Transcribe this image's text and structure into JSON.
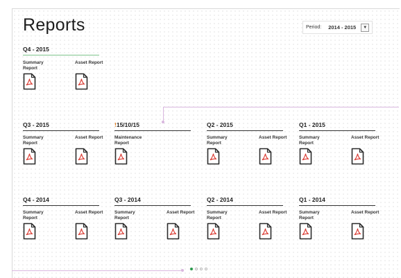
{
  "page": {
    "title": "Reports"
  },
  "period": {
    "label": "Period:",
    "value": "2014 - 2015",
    "dropdown_icon": "triangle-down-icon"
  },
  "colors": {
    "accent_green": "#2a9a4c",
    "pdf_red": "#d9342b",
    "connector": "#d9b7df"
  },
  "groups": [
    {
      "title": "Q4 - 2015",
      "active": true,
      "reports": [
        {
          "label": "Summary Report",
          "icon": "pdf-icon"
        },
        {
          "label": "Asset Report",
          "icon": "pdf-icon"
        }
      ]
    },
    {
      "title": "Q3 - 2015",
      "reports": [
        {
          "label": "Summary Report",
          "icon": "pdf-icon"
        },
        {
          "label": "Asset Report",
          "icon": "pdf-icon"
        }
      ]
    },
    {
      "title": "15/10/15",
      "flag": "!",
      "reports": [
        {
          "label": "Maintenance Report",
          "icon": "pdf-icon"
        }
      ]
    },
    {
      "title": "Q2 - 2015",
      "reports": [
        {
          "label": "Summary Report",
          "icon": "pdf-icon"
        },
        {
          "label": "Asset Report",
          "icon": "pdf-icon"
        }
      ]
    },
    {
      "title": "Q1 - 2015",
      "reports": [
        {
          "label": "Summary Report",
          "icon": "pdf-icon"
        },
        {
          "label": "Asset Report",
          "icon": "pdf-icon"
        }
      ]
    },
    {
      "title": "Q4 - 2014",
      "reports": [
        {
          "label": "Summary Report",
          "icon": "pdf-icon"
        },
        {
          "label": "Asset Report",
          "icon": "pdf-icon"
        }
      ]
    },
    {
      "title": "Q3 - 2014",
      "reports": [
        {
          "label": "Summary Report",
          "icon": "pdf-icon"
        },
        {
          "label": "Asset Report",
          "icon": "pdf-icon"
        }
      ]
    },
    {
      "title": "Q2 - 2014",
      "reports": [
        {
          "label": "Summary Report",
          "icon": "pdf-icon"
        },
        {
          "label": "Asset Report",
          "icon": "pdf-icon"
        }
      ]
    },
    {
      "title": "Q1 - 2014",
      "reports": [
        {
          "label": "Summary Report",
          "icon": "pdf-icon"
        },
        {
          "label": "Asset Report",
          "icon": "pdf-icon"
        }
      ]
    }
  ],
  "pagination": {
    "pages": 4,
    "current": 1
  }
}
